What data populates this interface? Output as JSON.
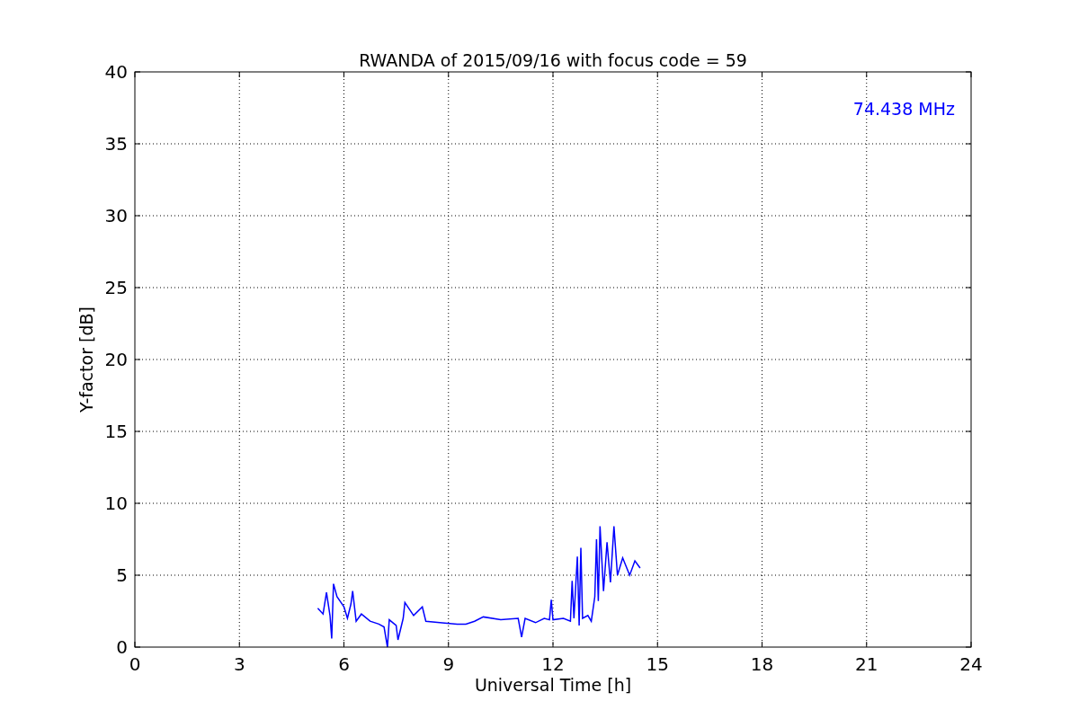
{
  "chart_data": {
    "type": "line",
    "title": "RWANDA of 2015/09/16 with focus code = 59",
    "xlabel": "Universal Time [h]",
    "ylabel": "Y-factor [dB]",
    "x": [
      5.25,
      5.4,
      5.5,
      5.6,
      5.65,
      5.7,
      5.8,
      6.0,
      6.1,
      6.2,
      6.25,
      6.35,
      6.5,
      6.75,
      7.0,
      7.15,
      7.25,
      7.3,
      7.5,
      7.55,
      7.7,
      7.75,
      8.0,
      8.25,
      8.35,
      8.75,
      9.25,
      9.5,
      9.75,
      10.0,
      10.5,
      11.0,
      11.1,
      11.2,
      11.5,
      11.75,
      11.9,
      11.95,
      12.0,
      12.3,
      12.5,
      12.55,
      12.6,
      12.7,
      12.75,
      12.8,
      12.85,
      13.0,
      13.1,
      13.2,
      13.25,
      13.3,
      13.35,
      13.45,
      13.55,
      13.65,
      13.75,
      13.85,
      14.0,
      14.2,
      14.35,
      14.5
    ],
    "series": [
      {
        "name": "74.438 MHz",
        "color": "#0000ff",
        "values": [
          2.7,
          2.3,
          3.8,
          2.2,
          0.6,
          4.4,
          3.5,
          2.8,
          2.0,
          3.0,
          3.9,
          1.8,
          2.3,
          1.8,
          1.6,
          1.4,
          0.0,
          1.9,
          1.5,
          0.5,
          2.0,
          3.1,
          2.2,
          2.8,
          1.8,
          1.7,
          1.6,
          1.6,
          1.8,
          2.1,
          1.9,
          2.0,
          0.7,
          2.0,
          1.7,
          2.0,
          1.9,
          3.3,
          1.9,
          2.0,
          1.8,
          4.6,
          2.0,
          6.3,
          1.5,
          6.9,
          2.0,
          2.2,
          1.8,
          3.5,
          7.5,
          3.2,
          8.4,
          3.9,
          7.3,
          4.5,
          8.4,
          5.0,
          6.2,
          5.0,
          6.0,
          5.5
        ]
      }
    ],
    "grid": true,
    "xlim": [
      0,
      24
    ],
    "ylim": [
      0,
      40
    ],
    "xticks": [
      0,
      3,
      6,
      9,
      12,
      15,
      18,
      21,
      24
    ],
    "yticks": [
      0,
      5,
      10,
      15,
      20,
      25,
      30,
      35,
      40
    ]
  }
}
